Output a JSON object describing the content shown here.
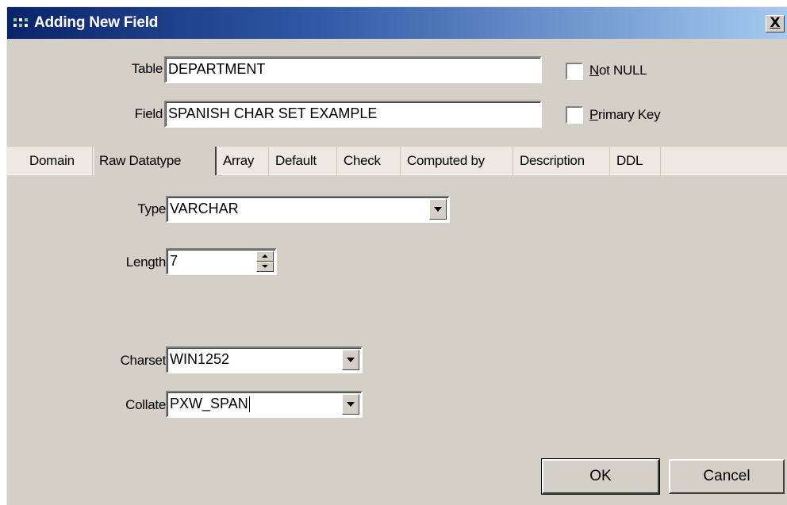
{
  "window": {
    "title": "Adding New Field",
    "close_label": "X"
  },
  "form": {
    "table_label": "Table",
    "table_value": "DEPARTMENT",
    "field_label": "Field",
    "field_value": "SPANISH CHAR SET EXAMPLE",
    "not_null_label_underlined": "N",
    "not_null_label_rest": "ot NULL",
    "not_null_checked": false,
    "primary_key_label_underlined": "P",
    "primary_key_label_rest": "rimary Key",
    "primary_key_checked": false
  },
  "tabs": [
    {
      "label": "Domain"
    },
    {
      "label": "Raw Datatype"
    },
    {
      "label": "Array"
    },
    {
      "label": "Default"
    },
    {
      "label": "Check"
    },
    {
      "label": "Computed by"
    },
    {
      "label": "Description"
    },
    {
      "label": "DDL"
    }
  ],
  "active_tab": "Raw Datatype",
  "raw_datatype": {
    "type_label": "Type",
    "type_value": "VARCHAR",
    "length_label": "Length",
    "length_value": "7",
    "charset_label": "Charset",
    "charset_value": "WIN1252",
    "collate_label": "Collate",
    "collate_value": "PXW_SPAN"
  },
  "buttons": {
    "ok_label": "OK",
    "cancel_label": "Cancel"
  },
  "icons": {
    "title": "field-grid-icon",
    "close": "close-icon",
    "dropdown": "chevron-down-icon",
    "spin_up": "spin-up-icon",
    "spin_down": "spin-down-icon"
  }
}
